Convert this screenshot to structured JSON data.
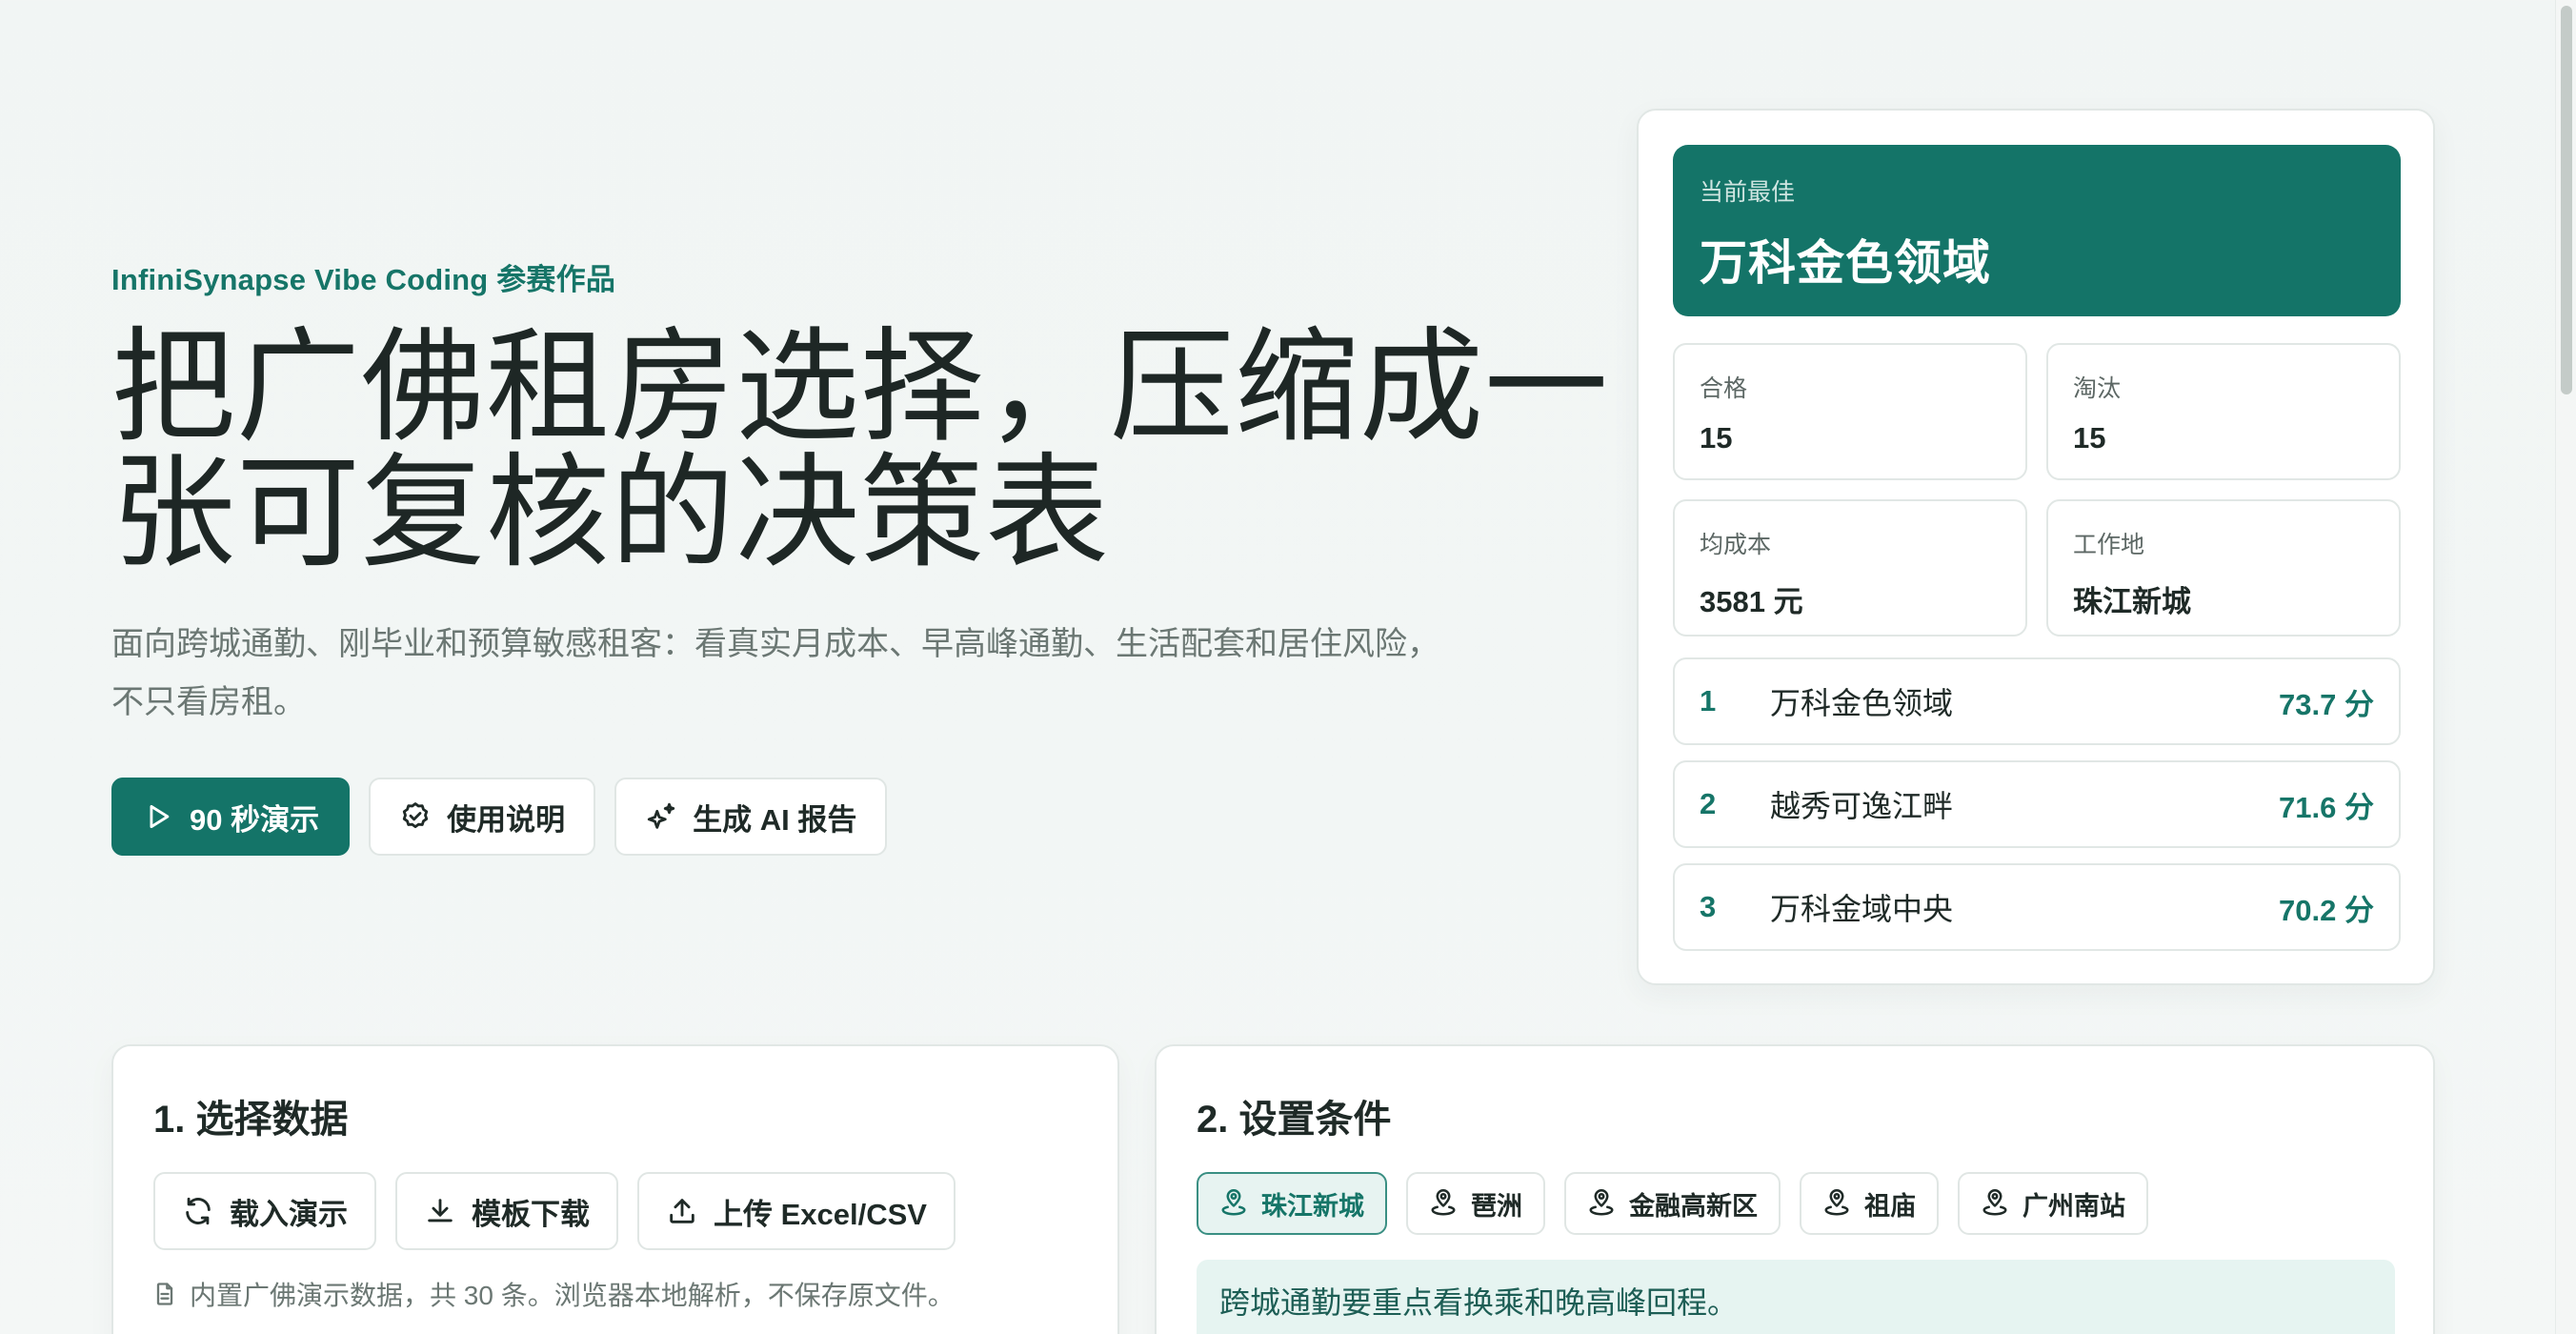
{
  "hero": {
    "eyebrow": "InfiniSynapse Vibe Coding 参赛作品",
    "title_line1": "把广佛租房选择，压缩成一",
    "title_line2": "张可复核的决策表",
    "description": "面向跨城通勤、刚毕业和预算敏感租客：看真实月成本、早高峰通勤、生活配套和居住风险，不只看房租。",
    "buttons": {
      "demo": "90 秒演示",
      "guide": "使用说明",
      "ai_report": "生成 AI 报告"
    }
  },
  "summary": {
    "best_label": "当前最佳",
    "best_name": "万科金色领域",
    "stats": {
      "qualified_label": "合格",
      "qualified_value": "15",
      "eliminated_label": "淘汰",
      "eliminated_value": "15",
      "avg_cost_label": "均成本",
      "avg_cost_value": "3581 元",
      "workplace_label": "工作地",
      "workplace_value": "珠江新城"
    },
    "ranking": [
      {
        "rank": "1",
        "name": "万科金色领域",
        "score": "73.7 分"
      },
      {
        "rank": "2",
        "name": "越秀可逸江畔",
        "score": "71.6 分"
      },
      {
        "rank": "3",
        "name": "万科金域中央",
        "score": "70.2 分"
      }
    ]
  },
  "data_panel": {
    "title": "1. 选择数据",
    "load_demo": "载入演示",
    "template_download": "模板下载",
    "upload": "上传 Excel/CSV",
    "note": "内置广佛演示数据，共 30 条。浏览器本地解析，不保存原文件。"
  },
  "condition_panel": {
    "title": "2. 设置条件",
    "locations": [
      "珠江新城",
      "琶洲",
      "金融高新区",
      "祖庙",
      "广州南站"
    ],
    "active_location": "珠江新城",
    "tip": "跨城通勤要重点看换乘和晚高峰回程。"
  },
  "colors": {
    "accent": "#147468",
    "accent_text": "#167568",
    "tip_bg": "#e6f4f1"
  }
}
